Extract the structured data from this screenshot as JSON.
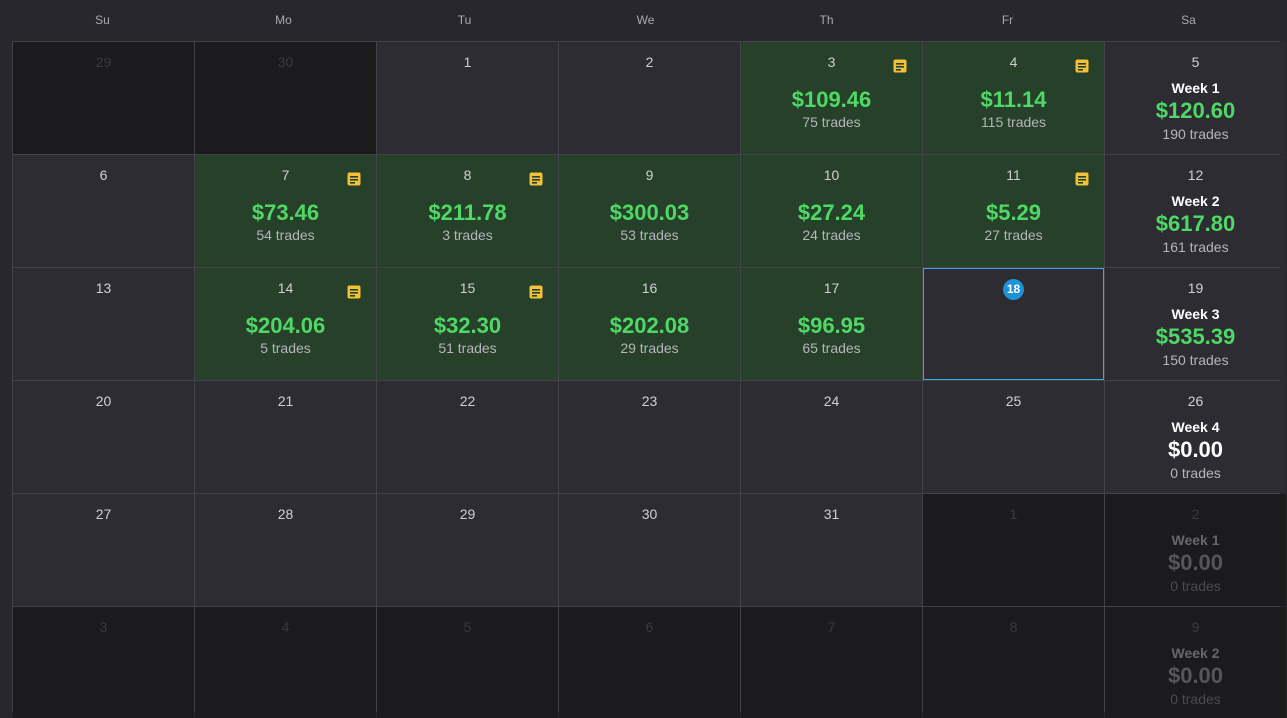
{
  "weekdays": [
    "Su",
    "Mo",
    "Tu",
    "We",
    "Th",
    "Fr",
    "Sa"
  ],
  "colors": {
    "profit_text": "#4fd865",
    "profit_cell": "#26402a",
    "note_icon": "#f3c038",
    "today_badge": "#1c93d6",
    "zero_week": "#ffffff"
  },
  "weeks": [
    {
      "days": [
        {
          "day": "29",
          "outside": true
        },
        {
          "day": "30",
          "outside": true
        },
        {
          "day": "1"
        },
        {
          "day": "2"
        },
        {
          "day": "3",
          "pnl": "$109.46",
          "trades": "75 trades",
          "note": true
        },
        {
          "day": "4",
          "pnl": "$11.14",
          "trades": "115 trades",
          "note": true
        }
      ],
      "summary": {
        "day": "5",
        "label": "Week 1",
        "pnl": "$120.60",
        "trades": "190 trades",
        "positive": true
      }
    },
    {
      "days": [
        {
          "day": "6"
        },
        {
          "day": "7",
          "pnl": "$73.46",
          "trades": "54 trades",
          "note": true
        },
        {
          "day": "8",
          "pnl": "$211.78",
          "trades": "3 trades",
          "note": true
        },
        {
          "day": "9",
          "pnl": "$300.03",
          "trades": "53 trades"
        },
        {
          "day": "10",
          "pnl": "$27.24",
          "trades": "24 trades"
        },
        {
          "day": "11",
          "pnl": "$5.29",
          "trades": "27 trades",
          "note": true
        }
      ],
      "summary": {
        "day": "12",
        "label": "Week 2",
        "pnl": "$617.80",
        "trades": "161 trades",
        "positive": true
      }
    },
    {
      "days": [
        {
          "day": "13"
        },
        {
          "day": "14",
          "pnl": "$204.06",
          "trades": "5 trades",
          "note": true
        },
        {
          "day": "15",
          "pnl": "$32.30",
          "trades": "51 trades",
          "note": true
        },
        {
          "day": "16",
          "pnl": "$202.08",
          "trades": "29 trades"
        },
        {
          "day": "17",
          "pnl": "$96.95",
          "trades": "65 trades"
        },
        {
          "day": "18",
          "today": true
        }
      ],
      "summary": {
        "day": "19",
        "label": "Week 3",
        "pnl": "$535.39",
        "trades": "150 trades",
        "positive": true
      }
    },
    {
      "days": [
        {
          "day": "20"
        },
        {
          "day": "21"
        },
        {
          "day": "22"
        },
        {
          "day": "23"
        },
        {
          "day": "24"
        },
        {
          "day": "25"
        }
      ],
      "summary": {
        "day": "26",
        "label": "Week 4",
        "pnl": "$0.00",
        "trades": "0 trades",
        "positive": false
      }
    },
    {
      "days": [
        {
          "day": "27"
        },
        {
          "day": "28"
        },
        {
          "day": "29"
        },
        {
          "day": "30"
        },
        {
          "day": "31"
        },
        {
          "day": "1",
          "outside": true
        }
      ],
      "summary": {
        "day": "2",
        "label": "Week 1",
        "pnl": "$0.00",
        "trades": "0 trades",
        "positive": false,
        "outside": true
      }
    },
    {
      "days": [
        {
          "day": "3",
          "outside": true
        },
        {
          "day": "4",
          "outside": true
        },
        {
          "day": "5",
          "outside": true
        },
        {
          "day": "6",
          "outside": true
        },
        {
          "day": "7",
          "outside": true
        },
        {
          "day": "8",
          "outside": true
        }
      ],
      "summary": {
        "day": "9",
        "label": "Week 2",
        "pnl": "$0.00",
        "trades": "0 trades",
        "positive": false,
        "outside": true
      }
    }
  ]
}
